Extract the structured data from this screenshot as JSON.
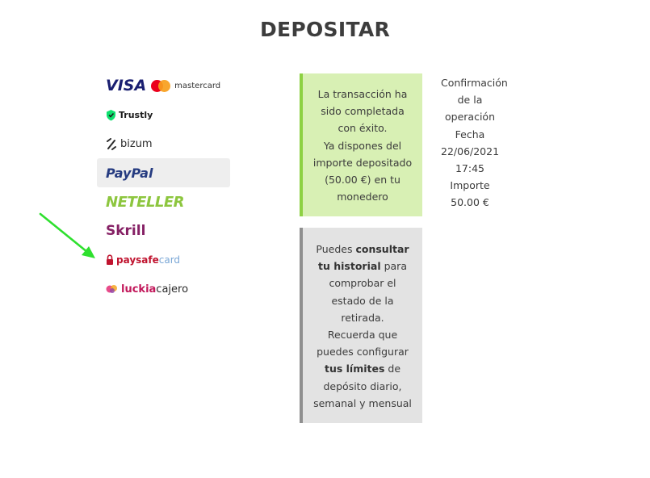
{
  "page": {
    "title": "DEPOSITAR"
  },
  "payment_methods": [
    {
      "name": "visa-mastercard",
      "visa": "VISA",
      "mastercard": "mastercard",
      "icon": "mastercard-circles-icon"
    },
    {
      "name": "trustly",
      "label": "Trustly",
      "icon": "trustly-shield-icon"
    },
    {
      "name": "bizum",
      "label": "bizum",
      "icon": "bizum-mark-icon"
    },
    {
      "name": "paypal",
      "label": "PayPal",
      "selected": true
    },
    {
      "name": "neteller",
      "label": "NETELLER"
    },
    {
      "name": "skrill",
      "label": "Skrill"
    },
    {
      "name": "paysafecard",
      "label_a": "paysafe",
      "label_b": "card",
      "icon": "padlock-icon"
    },
    {
      "name": "luckiacajero",
      "label_a": "luckia",
      "label_b": "cajero",
      "icon": "luckia-swirl-icon"
    }
  ],
  "success_box": {
    "lines": [
      "La transacción ha",
      "sido completada",
      "con éxito.",
      "Ya dispones del",
      "importe depositado",
      "(50.00 €) en tu",
      "monedero"
    ]
  },
  "info_box": {
    "l1": "Puedes ",
    "l1b": "consultar",
    "l2b": "tu historial",
    "l2": " para",
    "l3": "comprobar el",
    "l4": "estado de la",
    "l5": "retirada.",
    "l6": "Recuerda que",
    "l7": "puedes configurar",
    "l8b": "tus límites",
    "l8": " de",
    "l9": "depósito diario,",
    "l10": "semanal y mensual"
  },
  "confirmation": {
    "lines": [
      "Confirmación",
      "de la",
      "operación",
      "Fecha",
      "22/06/2021",
      "17:45",
      "Importe",
      "50.00 €"
    ]
  },
  "colors": {
    "success_bg": "#d8f0b4",
    "success_border": "#8dd142",
    "info_bg": "#e3e3e3",
    "info_border": "#8f8f8f",
    "arrow": "#2ee02e"
  },
  "annotation": {
    "icon": "green-arrow-icon"
  }
}
